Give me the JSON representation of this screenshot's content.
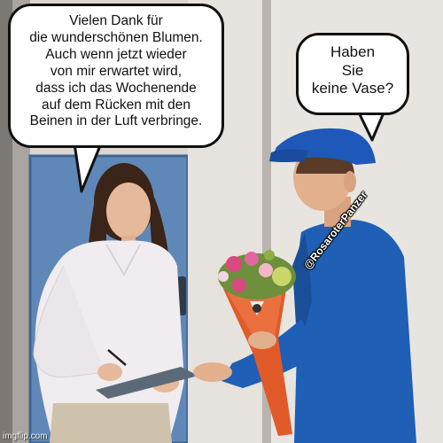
{
  "speech_bubbles": {
    "woman": {
      "lines": [
        "Vielen Dank für",
        "die wunderschönen Blumen.",
        "Auch wenn jetzt wieder",
        "von mir erwartet wird,",
        "dass ich das Wochenende",
        "auf dem Rücken mit den",
        "Beinen in der Luft verbringe."
      ]
    },
    "delivery_man": {
      "lines": [
        "Haben",
        "Sie",
        "keine Vase?"
      ]
    }
  },
  "watermarks": {
    "author": "@RosaroterPanzer",
    "site": "imgflip.com"
  },
  "colors": {
    "uniform_blue": "#1f5fb5",
    "cap_blue": "#1e58b8",
    "door_blue": "#5f88b8",
    "blouse": "#f0ecef",
    "hair": "#3b2418",
    "wrap_orange": "#e05a2a"
  }
}
